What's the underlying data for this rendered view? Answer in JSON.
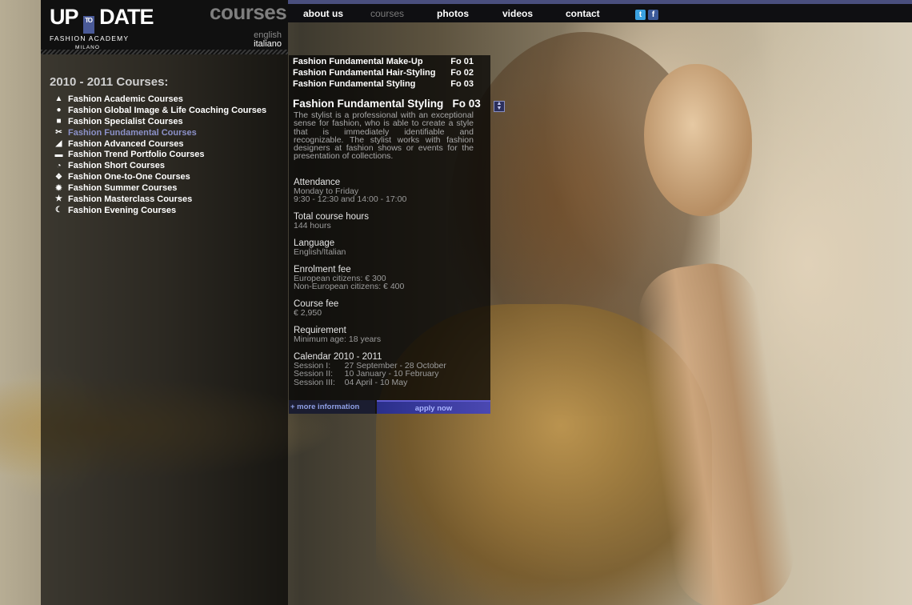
{
  "site": {
    "logo": {
      "up": "UP",
      "to": "TO",
      "date": "DATE",
      "academy": "FASHION ACADEMY",
      "city": "MILANO"
    },
    "section_title": "courses",
    "languages": [
      "english",
      "italiano"
    ]
  },
  "nav": {
    "items": [
      {
        "label": "about us"
      },
      {
        "label": "courses",
        "active": true
      },
      {
        "label": "photos"
      },
      {
        "label": "videos"
      },
      {
        "label": "contact"
      }
    ],
    "social": [
      {
        "icon": "twitter-icon"
      },
      {
        "icon": "facebook-icon"
      }
    ]
  },
  "sidebar": {
    "heading": "2010 - 2011 Courses:",
    "items": [
      {
        "label": "Fashion Academic Courses",
        "icon": "graduation-cap-icon"
      },
      {
        "label": "Fashion Global Image & Life Coaching Courses",
        "icon": "person-icon"
      },
      {
        "label": "Fashion Specialist Courses",
        "icon": "shirt-icon"
      },
      {
        "label": "Fashion Fundamental Courses",
        "icon": "scissors-icon",
        "active": true
      },
      {
        "label": "Fashion Advanced Courses",
        "icon": "chart-icon"
      },
      {
        "label": "Fashion Trend Portfolio Courses",
        "icon": "hat-icon"
      },
      {
        "label": "Fashion Short Courses",
        "icon": "clock-icon"
      },
      {
        "label": "Fashion One-to-One Courses",
        "icon": "people-icon"
      },
      {
        "label": "Fashion Summer Courses",
        "icon": "sun-icon"
      },
      {
        "label": "Fashion Masterclass Courses",
        "icon": "star-icon"
      },
      {
        "label": "Fashion Evening Courses",
        "icon": "moon-icon"
      }
    ]
  },
  "detail": {
    "codes": [
      {
        "name": "Fashion Fundamental Make-Up",
        "code": "Fo 01"
      },
      {
        "name": "Fashion Fundamental Hair-Styling",
        "code": "Fo 02"
      },
      {
        "name": "Fashion Fundamental Styling",
        "code": "Fo 03"
      }
    ],
    "title": "Fashion Fundamental Styling   Fo 03",
    "description": "The stylist is a professional with an exceptional sense for fashion, who is able to create a style that is immediately identifiable and recognizable. The stylist works with fashion designers at fashion shows or events for the presentation of collections.",
    "info": [
      {
        "label": "Attendance",
        "value": "Monday to Friday\n9:30 - 12:30 and 14:00 - 17:00"
      },
      {
        "label": "Total course hours",
        "value": "144 hours"
      },
      {
        "label": "Language",
        "value": "English/Italian"
      },
      {
        "label": "Enrolment fee",
        "value": "European citizens: € 300\nNon-European citizens: € 400"
      },
      {
        "label": "Course fee",
        "value": "€ 2,950"
      },
      {
        "label": "Requirement",
        "value": "Minimum age: 18 years"
      },
      {
        "label": "Calendar 2010 - 2011",
        "value": "Session I:      27 September - 28 October\nSession II:     10 January - 10 February\nSession III:    04 April - 10 May"
      }
    ],
    "more_label": "+ more information",
    "apply_label": "apply now"
  },
  "colors": {
    "nav_accent": "#4a4f7e",
    "active_link": "#8c91c9",
    "apply_bg": "#4b48b2"
  }
}
